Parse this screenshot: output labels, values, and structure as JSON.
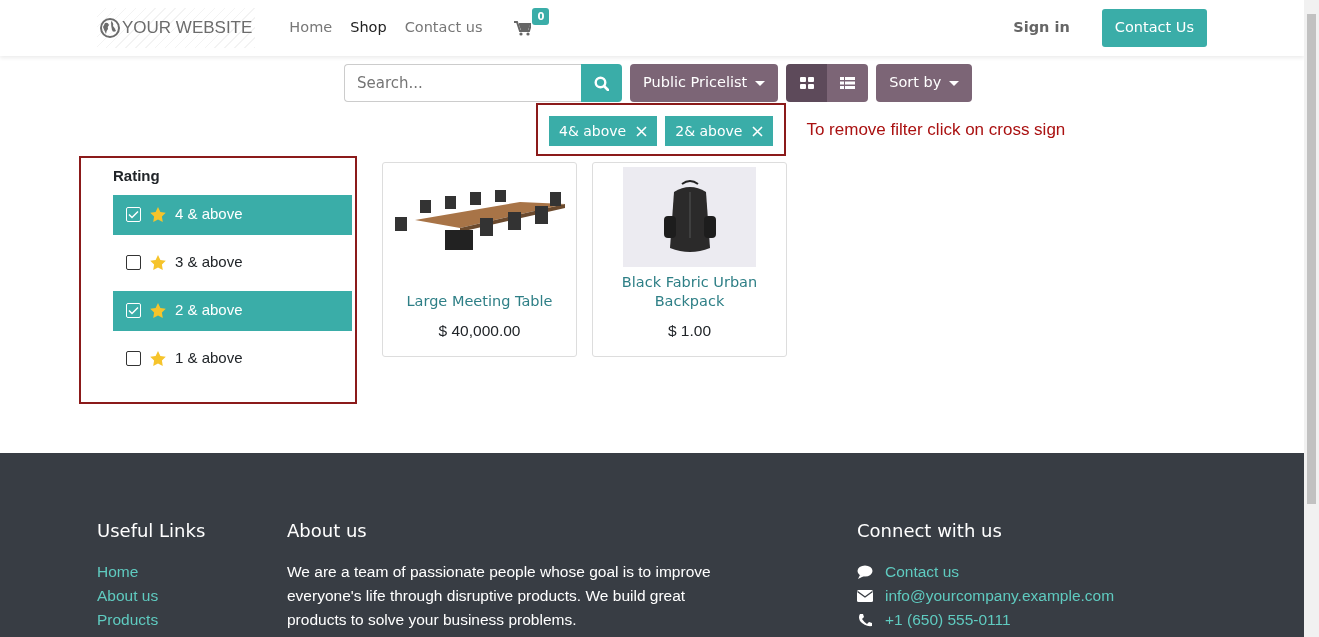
{
  "header": {
    "logo": "YOUR WEBSITE",
    "nav": [
      {
        "label": "Home",
        "selected": false
      },
      {
        "label": "Shop",
        "selected": true
      },
      {
        "label": "Contact us",
        "selected": false
      }
    ],
    "cart_count": "0",
    "sign_in": "Sign in",
    "contact_button": "Contact Us"
  },
  "toolbar": {
    "search": {
      "placeholder": "Search..."
    },
    "pricelist": "Public Pricelist",
    "views": [
      {
        "kind": "grid",
        "selected": true
      },
      {
        "kind": "list",
        "selected": false
      }
    ],
    "sort": "Sort by"
  },
  "active_filters": [
    "4& above",
    "2& above"
  ],
  "annotation": "To remove filter click on cross sign",
  "rating": {
    "title": "Rating",
    "options": [
      {
        "label": "4 & above",
        "checked": true
      },
      {
        "label": "3 & above",
        "checked": false
      },
      {
        "label": "2 & above",
        "checked": true
      },
      {
        "label": "1 & above",
        "checked": false
      }
    ]
  },
  "products": [
    {
      "kind": "table",
      "name": "Large Meeting Table",
      "price": "$ 40,000.00"
    },
    {
      "kind": "backpack",
      "name": "Black Fabric Urban Backpack",
      "price": "$ 1.00"
    }
  ],
  "footer": {
    "useful_links": {
      "title": "Useful Links",
      "links": [
        "Home",
        "About us",
        "Products"
      ]
    },
    "about": {
      "title": "About us",
      "text": "We are a team of passionate people whose goal is to improve everyone's life through disruptive products. We build great products to solve your business problems."
    },
    "connect": {
      "title": "Connect with us",
      "items": [
        {
          "kind": "chat",
          "text": "Contact us"
        },
        {
          "kind": "mail",
          "text": "info@yourcompany.example.com"
        },
        {
          "kind": "phone",
          "text": "+1 (650) 555-0111"
        }
      ]
    }
  }
}
